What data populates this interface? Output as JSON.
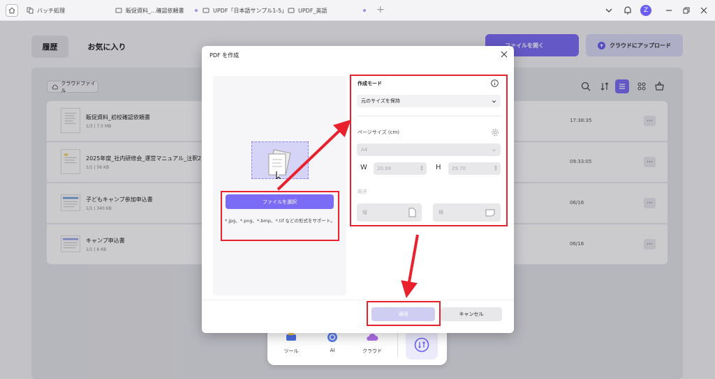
{
  "tabs": [
    {
      "label": "バッチ処理",
      "icon": "batch-icon"
    },
    {
      "label": "販促資料_...確認依頼書",
      "icon": "document-icon"
    },
    {
      "label": "UPDF「日本語サンプル1-5」",
      "icon": "document-icon"
    },
    {
      "label": "UPDF_英語",
      "icon": "document-icon"
    }
  ],
  "user_avatar": "Z",
  "nav": {
    "history": "履歴",
    "favorites": "お気に入り"
  },
  "actions": {
    "open_file": "ファイルを開く",
    "upload_cloud": "クラウドにアップロード"
  },
  "cloud_files": "クラウドファイル",
  "files": [
    {
      "title": "販促資料_初校確認依頼書",
      "meta": "1/3 | 7.5 MB",
      "time": "17:38:35"
    },
    {
      "title": "2025年度_社内研修会_運営マニュアル_注釈2",
      "meta": "1/1 | 56 KB",
      "time": "09:33:05"
    },
    {
      "title": "子どもキャンプ参加申込書",
      "meta": "1/1 | 340 KB",
      "time": "06/16"
    },
    {
      "title": "キャンプ申込書",
      "meta": "1/1 | 6 KB",
      "time": "06/16"
    }
  ],
  "more_label": "···",
  "dock": {
    "tools": "ツール",
    "ai": "AI",
    "cloud": "クラウド"
  },
  "dialog": {
    "title": "PDF を作成",
    "select_file": "ファイルを選択",
    "supported_formats": "*.jpg、*.png、*.bmp、*.tif などの形式をサポート。",
    "mode_label": "作成モード",
    "mode_value": "元のサイズを保持",
    "page_size_label": "ページサイズ",
    "page_size_unit": "(cm)",
    "size_value": "A4",
    "w_label": "W",
    "w_value": "20.99",
    "h_label": "H",
    "h_value": "29.70",
    "orientation_label": "向き",
    "portrait": "縦",
    "landscape": "横",
    "apply": "適用",
    "cancel": "キャンセル"
  },
  "colors": {
    "accent": "#7b6cf6",
    "highlight_red": "#e8212d"
  }
}
